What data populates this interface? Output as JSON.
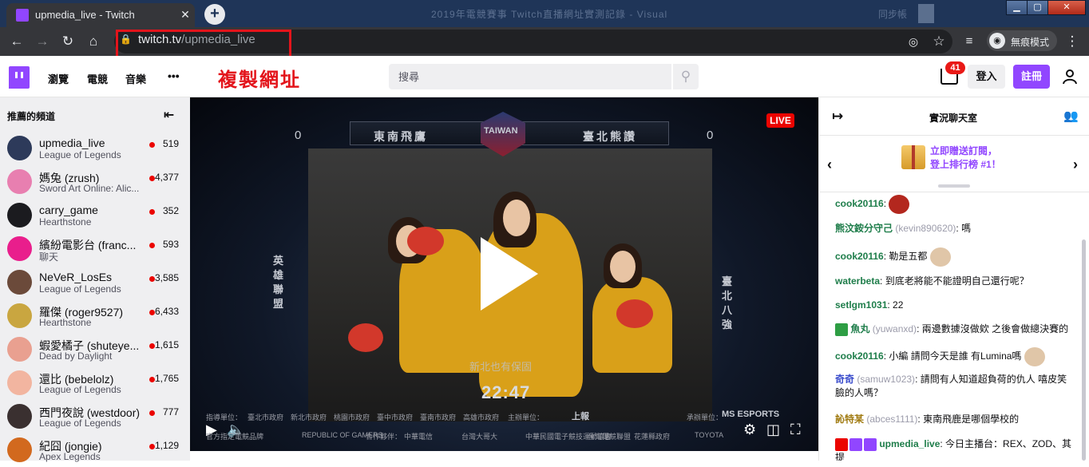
{
  "browser": {
    "tab_title": "upmedia_live - Twitch",
    "tab_close": "✕",
    "new_tab": "+",
    "blurred_title": "2019年電競賽事 Twitch直播網址實測記錄 - Visual",
    "blurred_user": "同步帳",
    "url_domain": "twitch.tv",
    "url_path": "/upmedia_live",
    "incognito_label": "無痕模式",
    "incognito_icon": "incognito-icon"
  },
  "annotation": {
    "copy_url": "複製網址"
  },
  "twitch_nav": {
    "links": [
      "瀏覽",
      "電競",
      "音樂"
    ],
    "more": "•••",
    "search_placeholder": "搜尋",
    "notification_count": "41",
    "login": "登入",
    "signup": "註冊"
  },
  "sidebar": {
    "title": "推薦的頻道",
    "channels": [
      {
        "name": "upmedia_live",
        "game": "League of Legends",
        "viewers": "519",
        "color": "#2d3a5a"
      },
      {
        "name": "媽兔 (zrush)",
        "game": "Sword Art Online: Alic...",
        "viewers": "4,377",
        "color": "#e87fb0"
      },
      {
        "name": "carry_game",
        "game": "Hearthstone",
        "viewers": "352",
        "color": "#1b1b1f"
      },
      {
        "name": "繽紛電影台 (franc...",
        "game": "聊天",
        "viewers": "593",
        "color": "#e91e8c"
      },
      {
        "name": "NeVeR_LosEs",
        "game": "League of Legends",
        "viewers": "3,585",
        "color": "#6b4a3a"
      },
      {
        "name": "羅傑 (roger9527)",
        "game": "Hearthstone",
        "viewers": "6,433",
        "color": "#c9a640"
      },
      {
        "name": "蝦愛橘子 (shuteye...",
        "game": "Dead by Daylight",
        "viewers": "1,615",
        "color": "#e9a090"
      },
      {
        "name": "還比 (bebelolz)",
        "game": "League of Legends",
        "viewers": "1,765",
        "color": "#f2b5a0"
      },
      {
        "name": "西門夜說 (westdoor)",
        "game": "League of Legends",
        "viewers": "777",
        "color": "#3a3030"
      },
      {
        "name": "紀囧 (jongie)",
        "game": "Apex Legends",
        "viewers": "1,129",
        "color": "#d2691e"
      }
    ]
  },
  "video": {
    "live": "LIVE",
    "team_left": "東南飛鷹",
    "team_right": "臺北熊讚",
    "logo": "TAIWAN",
    "score_left": "0",
    "score_right": "0",
    "side_left": "英雄聯盟",
    "side_right": "臺北八強",
    "subtitle": "新北也有保固",
    "timer": "22:47",
    "sponsors1": [
      "指導單位：",
      "臺北市政府",
      "新北市政府",
      "桃園市政府",
      "臺中市政府",
      "臺南市政府",
      "高雄市政府",
      "主辦單位：",
      "上報",
      "承辦單位：",
      "MS ESPORTS"
    ],
    "sponsors2": [
      "官方指定電競品牌",
      "REPUBLIC OF GAMERS",
      "合作夥伴：",
      "中華電信",
      "台灣大哥大",
      "中華民國電子競技運動協會",
      "台灣電競聯盟",
      "花蓮縣政府",
      "TOYOTA"
    ]
  },
  "chat": {
    "title": "實況聊天室",
    "gift_line1": "立即贈送訂閱，",
    "gift_line2": "登上排行榜 #1！",
    "messages": [
      {
        "user": "cook20116",
        "id": "",
        "text": "",
        "color": "#1e7d4a"
      },
      {
        "user": "熊汶銨分守己",
        "id": "(kevin890620)",
        "text": "嗎",
        "color": "#1e7d4a"
      },
      {
        "user": "cook20116",
        "id": "",
        "text": "勒是五都",
        "color": "#1e7d4a"
      },
      {
        "user": "waterbeta",
        "id": "",
        "text": "到底老將能不能證明自己還行呢？",
        "color": "#1e7d4a"
      },
      {
        "user": "setlgm1031",
        "id": "",
        "text": "22",
        "color": "#1e7d4a"
      },
      {
        "user": "魚丸",
        "id": "(yuwanxd)",
        "text": "兩邊數據沒做欸 之後會做總決賽的",
        "color": "#1e7d4a"
      },
      {
        "user": "cook20116",
        "id": "",
        "text": "小編 請問今天是誰 有Lumina嗎",
        "color": "#1e7d4a"
      },
      {
        "user": "奇奇",
        "id": "(samuw1023)",
        "text": "請問有人知道超負荷的仇人 嘻皮笑臉的人嗎？",
        "color": "#3a4ccc"
      },
      {
        "user": "訫特某",
        "id": "(abces1111)",
        "text": "東南飛鹿是哪個學校的",
        "color": "#a07a10"
      },
      {
        "user": "upmedia_live",
        "id": "",
        "text": "今日主播台：REX、ZOD、其提",
        "color": "#1e7d4a"
      }
    ]
  }
}
